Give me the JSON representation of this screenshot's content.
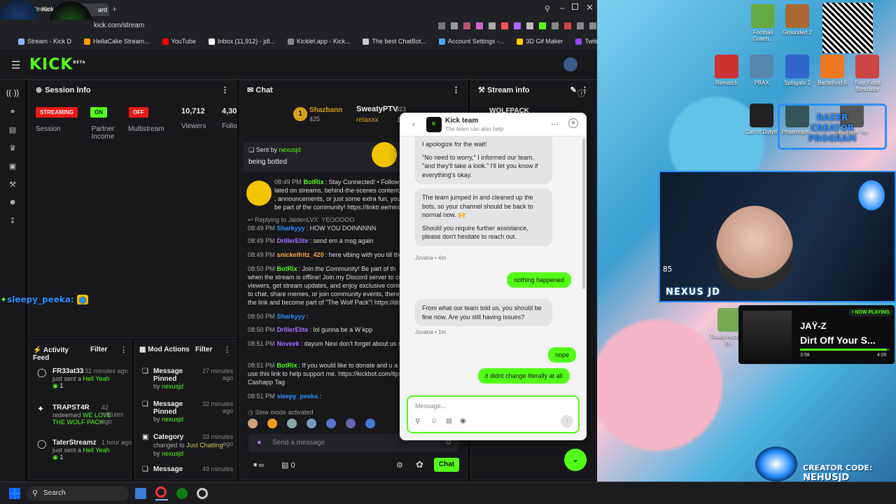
{
  "browser": {
    "tab_title": "Stream",
    "tab2": "Kick D",
    "dashboard_tab": "ard",
    "url": "kick.com/stream",
    "bookmarks": [
      "Stream - Kick D",
      "HellaCake Stream...",
      "YouTube",
      "Inbox (11,912) - jdl...",
      "Kicklet.app - Kick...",
      "The best ChatBot...",
      "Account Settings -...",
      "3D Gif Maker",
      "Twitch"
    ]
  },
  "kick": {
    "logo": "KICK",
    "beta": "BETA"
  },
  "session": {
    "title": "Session Info",
    "streaming": "STREAMING",
    "on": "ON",
    "off": "OFF",
    "session_label": "Session",
    "partner_label": "Partner Income",
    "multistream_label": "Multistream",
    "viewers": "10,712",
    "viewers_label": "Viewers",
    "followers": "4,30",
    "followers_label": "Follo"
  },
  "activity": {
    "title": "Activity Feed",
    "filter": "Filter",
    "items": [
      {
        "name": "FR33at33",
        "time": "32 minutes ago",
        "text": "just sent a",
        "highlight": "Hell Yeah",
        "count": "1"
      },
      {
        "name": "TRAPST4R",
        "time": "42 minutes ago",
        "text": "redeemed",
        "highlight": "WE LOVE THE WOLF PACK"
      },
      {
        "name": "TaterStreamz",
        "time": "1 hour ago",
        "text": "just sent a",
        "highlight": "Hell Yeah",
        "count": "1"
      }
    ]
  },
  "mod": {
    "title": "Mod Actions",
    "filter": "Filter",
    "items": [
      {
        "title": "Message Pinned",
        "time": "27 minutes ago",
        "by": "by",
        "user": "nexusjd"
      },
      {
        "title": "Message Pinned",
        "time": "32 minutes ago",
        "by": "by",
        "user": "nexusjd"
      },
      {
        "title": "Category",
        "time": "33 minutes ago",
        "changed": "changed to",
        "value": "Just Chatting",
        "by": "by",
        "user": "nexusjd"
      },
      {
        "title": "Message",
        "time": "49 minutes"
      }
    ]
  },
  "chat": {
    "title": "Chat",
    "top1": "Shazbann",
    "top1_count": "425",
    "top2": "SweatyPTV",
    "top2_count": "323",
    "top3": "relaxxx",
    "top3_count": "18",
    "pinned_sentby": "Sent by",
    "pinned_user": "nexusjd",
    "pinned_text": "being botted",
    "messages": [
      {
        "ts": "08:49 PM",
        "user": "BotRix",
        "text": ": Stay Connected! • Follow me on"
      },
      {
        "ts": "",
        "user": "",
        "text": "lated on streams, behind-the-scenes content, and"
      },
      {
        "ts": "",
        "user": "",
        "text": ", announcements, or just some extra fun, you'll"
      },
      {
        "ts": "",
        "user": "",
        "text": "be part of the community! https://linktr.ee/nexusj"
      },
      {
        "ts": "",
        "user": "",
        "text": "Replying to JaidenLVX: YEOOOOO"
      },
      {
        "ts": "08:49 PM",
        "user": "Sharkyyy",
        "text": ": HOW YOU DOINNNNN"
      },
      {
        "ts": "08:49 PM",
        "user": "DrillerElite",
        "text": ": send em a msg again"
      },
      {
        "ts": "08:49 PM",
        "user": "snickelfritz_420",
        "text": ": here vibing with you till the end"
      },
      {
        "ts": "08:50 PM",
        "user": "BotRix",
        "text": ": Join the Community! Be part of th"
      },
      {
        "ts": "",
        "user": "",
        "text": "when the stream is offline! Join my Discord server to conn"
      },
      {
        "ts": "",
        "user": "",
        "text": "viewers, get stream updates, and enjoy exclusive content"
      },
      {
        "ts": "",
        "user": "",
        "text": "to chat, share memes, or join community events, there's a"
      },
      {
        "ts": "",
        "user": "",
        "text": "the link and become part of \"The Wolf Pack\"! https://disc"
      },
      {
        "ts": "08:50 PM",
        "user": "Sharkyyy",
        "text": ":"
      },
      {
        "ts": "08:50 PM",
        "user": "DrillerElite",
        "text": ": lol gunna be a W kpp"
      },
      {
        "ts": "08:51 PM",
        "user": "Noveek",
        "text": ": dayum Nexi don't forget about us sl"
      },
      {
        "ts": "08:51 PM",
        "user": "BotRix",
        "text": ": If you would like to donate and u a"
      },
      {
        "ts": "",
        "user": "",
        "text": "use this link to help support me. https://kickbot.com/tips/"
      },
      {
        "ts": "",
        "user": "",
        "text": "Cashapp Tag"
      },
      {
        "ts": "08:51 PM",
        "user": "sleepy_peeka",
        "text": ":"
      }
    ],
    "slow_mode": "Slow mode activated",
    "send_placeholder": "Send a message",
    "points": "0",
    "chat_button": "Chat",
    "overlay_user": "sleepy_peeka:"
  },
  "streaminfo": {
    "title": "Stream info",
    "game": "WOLFPACK"
  },
  "support": {
    "title": "Kick team",
    "subtitle": "The team can also help",
    "m1": "I apologize for the wait!",
    "m2": "\"No need to worry,\" I informed our team, \"and they'll take a look.\" I'll let you know if everything's okay.",
    "m3": "The team jumped in and cleaned up the bots, so your channel should be back to normal now. 🙌",
    "m4": "Should you require further assistance, please don't hesitate to reach out.",
    "meta1": "Jovana • 4m",
    "mine1": "nothing happened",
    "m5": "From what our team told us, you should be fine now. Are you still having issues?",
    "meta2": "Jovana • 1m",
    "mine2": "nope",
    "mine3": "it didnt change literally at all",
    "placeholder": "Message..."
  },
  "stream": {
    "desktop_icons": [
      "Football Coach...",
      "Grounded 2",
      "Rematch",
      "PBAX",
      "Splitgate 2",
      "Battlefield 6",
      "Fast Food Simulator",
      "Call of Duty®",
      "Phasmoph...",
      "Not Here Yet",
      "Totally Accurate B..."
    ],
    "razer": "RAZER CREATOR PROGRAM",
    "nexus": "NEXUS JD",
    "now_playing": "• NOW PLAYING",
    "artist": "JAŸ-Z",
    "song": "Dirt Off Your S...",
    "t_start": "3:58",
    "t_end": "4:05",
    "progress": 0.97,
    "creator_code_label": "CREATOR CODE:",
    "creator_code": "NEHUSJD",
    "counter": "85"
  },
  "taskbar": {
    "search": "Search"
  },
  "colors": {
    "kick_green": "#53fc18",
    "streaming_red": "#e91916"
  }
}
